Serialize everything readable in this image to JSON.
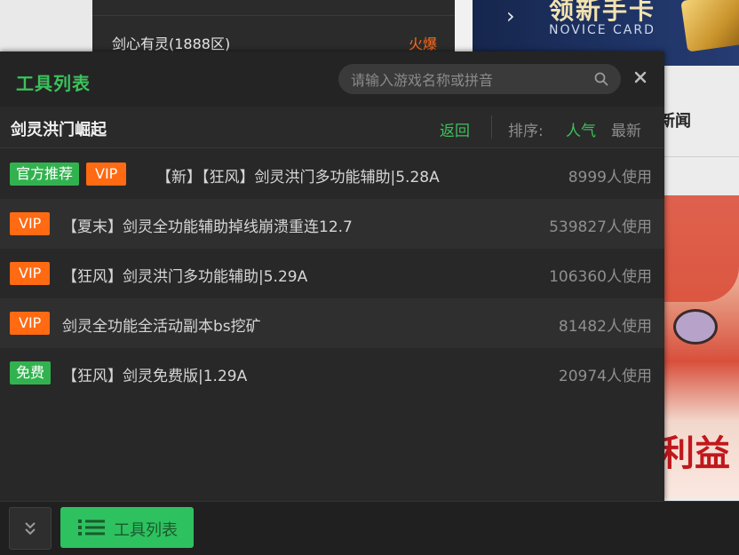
{
  "background": {
    "server_item": "剑心有灵(1888区)",
    "server_status": "火爆",
    "banner_cn": "领新手卡",
    "banner_en": "NOVICE CARD",
    "news_label": "新闻",
    "art_text": "利益"
  },
  "panel": {
    "title": "工具列表",
    "search_placeholder": "请输入游戏名称或拼音",
    "game_name": "剑灵洪门崛起",
    "back_label": "返回",
    "sort_label": "排序:",
    "sort_popular": "人气",
    "sort_newest": "最新",
    "tools": [
      {
        "badges": [
          "官方推荐",
          "VIP"
        ],
        "badge_types": [
          "rec",
          "vip"
        ],
        "name": "【新】【狂风】剑灵洪门多功能辅助|5.28A",
        "users": "8999人使用"
      },
      {
        "badges": [
          "VIP"
        ],
        "badge_types": [
          "vip"
        ],
        "name": "【夏末】剑灵全功能辅助掉线崩溃重连12.7",
        "users": "539827人使用"
      },
      {
        "badges": [
          "VIP"
        ],
        "badge_types": [
          "vip"
        ],
        "name": "【狂风】剑灵洪门多功能辅助|5.29A",
        "users": "106360人使用"
      },
      {
        "badges": [
          "VIP"
        ],
        "badge_types": [
          "vip"
        ],
        "name": "剑灵全功能全活动副本bs挖矿",
        "users": "81482人使用"
      },
      {
        "badges": [
          "免费"
        ],
        "badge_types": [
          "free"
        ],
        "name": "【狂风】剑灵免费版|1.29A",
        "users": "20974人使用"
      }
    ]
  },
  "bottom_bar": {
    "tools_button_label": "工具列表"
  },
  "colors": {
    "accent_green": "#3cc15c",
    "vip_orange": "#ff6a12",
    "hot_orange": "#ff6a1a"
  }
}
